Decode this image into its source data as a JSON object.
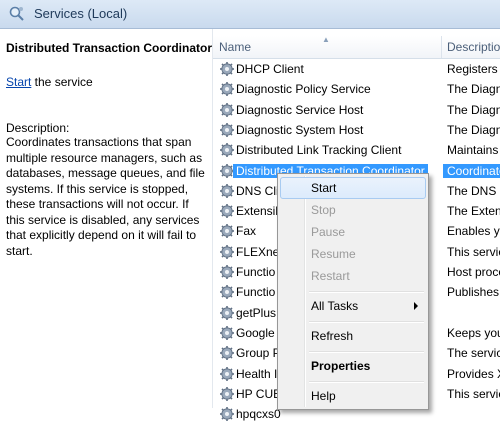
{
  "header": {
    "title": "Services (Local)",
    "icon": "services-magnifier-icon"
  },
  "left_pane": {
    "service_title": "Distributed Transaction Coordinator",
    "start_link": "Start",
    "start_suffix": " the service",
    "description_label": "Description:",
    "description": "Coordinates transactions that span multiple resource managers, such as databases, message queues, and file systems. If this service is stopped, these transactions will not occur. If this service is disabled, any services that explicitly depend on it will fail to start."
  },
  "list": {
    "columns": {
      "name": "Name",
      "description": "Descriptio"
    },
    "rows": [
      {
        "name": "DHCP Client",
        "description": "Registers a"
      },
      {
        "name": "Diagnostic Policy Service",
        "description": "The Diagno"
      },
      {
        "name": "Diagnostic Service Host",
        "description": "The Diagno"
      },
      {
        "name": "Diagnostic System Host",
        "description": "The Diagno"
      },
      {
        "name": "Distributed Link Tracking Client",
        "description": "Maintains li"
      },
      {
        "name": "Distributed Transaction Coordinator",
        "description": "Coordinate"
      },
      {
        "name": "DNS Cli",
        "description": "The DNS C"
      },
      {
        "name": "Extensib",
        "description": "The Extens"
      },
      {
        "name": "Fax",
        "description": "Enables yo"
      },
      {
        "name": "FLEXnet",
        "description": "This servic"
      },
      {
        "name": "Functio",
        "description": "Host proce"
      },
      {
        "name": "Functio",
        "description": "Publishes t"
      },
      {
        "name": "getPlus",
        "description": ""
      },
      {
        "name": "Google",
        "description": "Keeps you"
      },
      {
        "name": "Group P",
        "description": "The service"
      },
      {
        "name": "Health I",
        "description": "Provides X"
      },
      {
        "name": "HP CUE",
        "description": "This servic"
      },
      {
        "name": "hpqcxs0",
        "description": ""
      }
    ]
  },
  "context_menu": {
    "start": "Start",
    "stop": "Stop",
    "pause": "Pause",
    "resume": "Resume",
    "restart": "Restart",
    "all_tasks": "All Tasks",
    "refresh": "Refresh",
    "properties": "Properties",
    "help": "Help"
  },
  "colors": {
    "selection": "#3399ff",
    "link": "#0645ad",
    "menu_bg": "#f0f0f0"
  }
}
